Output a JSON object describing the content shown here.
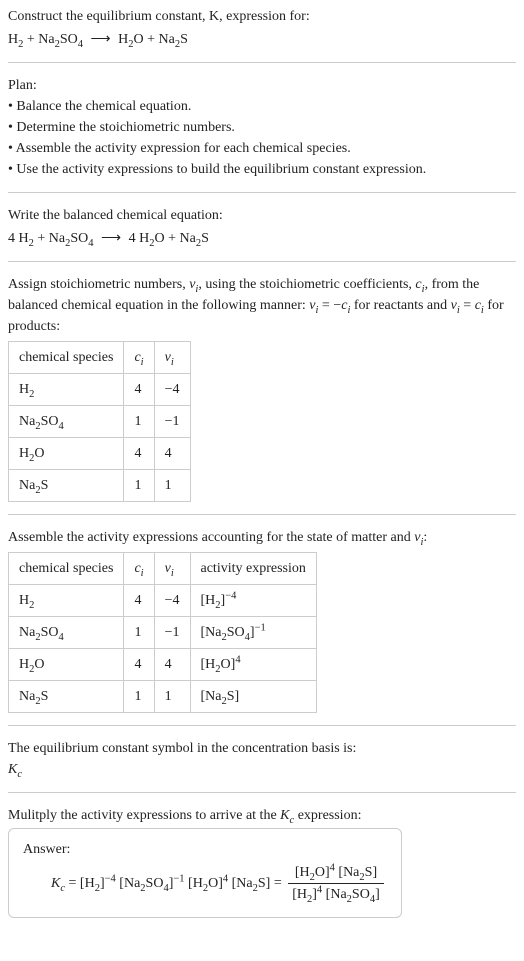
{
  "intro": {
    "l1": "Construct the equilibrium constant, K, expression for:",
    "eq_left_h2": "H",
    "eq_left_h2_sub": "2",
    "plus": " + ",
    "na2so4_a": "Na",
    "na2so4_b": "2",
    "na2so4_c": "SO",
    "na2so4_d": "4",
    "arrow": "⟶",
    "h2o_a": "H",
    "h2o_b": "2",
    "h2o_c": "O",
    "na2s_a": "Na",
    "na2s_b": "2",
    "na2s_c": "S"
  },
  "plan": {
    "header": "Plan:",
    "b1": "• Balance the chemical equation.",
    "b2": "• Determine the stoichiometric numbers.",
    "b3": "• Assemble the activity expression for each chemical species.",
    "b4": "• Use the activity expressions to build the equilibrium constant expression."
  },
  "balanced": {
    "header": "Write the balanced chemical equation:",
    "c1": "4 H",
    "c1s": "2",
    "plus": " + ",
    "c2a": "Na",
    "c2b": "2",
    "c2c": "SO",
    "c2d": "4",
    "arrow": "⟶",
    "c3": "4 H",
    "c3a": "2",
    "c3b": "O",
    "c4a": "Na",
    "c4b": "2",
    "c4c": "S"
  },
  "stoich": {
    "p1a": "Assign stoichiometric numbers, ",
    "nu": "ν",
    "nu_i": "i",
    "p1b": ", using the stoichiometric coefficients, ",
    "c": "c",
    "c_i": "i",
    "p1c": ", from the balanced chemical equation in the following manner: ",
    "eq1a": "ν",
    "eq1b": "i",
    "eq1c": " = −",
    "eq1d": "c",
    "eq1e": "i",
    "p1d": " for reactants and ",
    "eq2a": "ν",
    "eq2b": "i",
    "eq2c": " = ",
    "eq2d": "c",
    "eq2e": "i",
    "p1e": " for products:"
  },
  "table1": {
    "h1": "chemical species",
    "h2a": "c",
    "h2b": "i",
    "h3a": "ν",
    "h3b": "i",
    "rows": [
      {
        "s_a": "H",
        "s_b": "2",
        "s_c": "",
        "s_d": "",
        "c": "4",
        "v": "−4"
      },
      {
        "s_a": "Na",
        "s_b": "2",
        "s_c": "SO",
        "s_d": "4",
        "c": "1",
        "v": "−1"
      },
      {
        "s_a": "H",
        "s_b": "2",
        "s_c": "O",
        "s_d": "",
        "c": "4",
        "v": "4"
      },
      {
        "s_a": "Na",
        "s_b": "2",
        "s_c": "S",
        "s_d": "",
        "c": "1",
        "v": "1"
      }
    ]
  },
  "assemble": {
    "p1a": "Assemble the activity expressions accounting for the state of matter and ",
    "nu": "ν",
    "nu_i": "i",
    "colon": ":"
  },
  "table2": {
    "h1": "chemical species",
    "h2a": "c",
    "h2b": "i",
    "h3a": "ν",
    "h3b": "i",
    "h4": "activity expression",
    "r1": {
      "s_a": "H",
      "s_b": "2",
      "c": "4",
      "v": "−4",
      "ax_a": "[H",
      "ax_b": "2",
      "ax_c": "]",
      "exp": "−4"
    },
    "r2": {
      "s_a": "Na",
      "s_b": "2",
      "s_c": "SO",
      "s_d": "4",
      "c": "1",
      "v": "−1",
      "ax_a": "[Na",
      "ax_b": "2",
      "ax_c": "SO",
      "ax_d": "4",
      "ax_e": "]",
      "exp": "−1"
    },
    "r3": {
      "s_a": "H",
      "s_b": "2",
      "s_c": "O",
      "c": "4",
      "v": "4",
      "ax_a": "[H",
      "ax_b": "2",
      "ax_c": "O]",
      "exp": "4"
    },
    "r4": {
      "s_a": "Na",
      "s_b": "2",
      "s_c": "S",
      "c": "1",
      "v": "1",
      "ax_a": "[Na",
      "ax_b": "2",
      "ax_c": "S]"
    }
  },
  "symbol": {
    "p": "The equilibrium constant symbol in the concentration basis is:",
    "k": "K",
    "ks": "c"
  },
  "mult": {
    "p1a": "Mulitply the activity expressions to arrive at the ",
    "k": "K",
    "ks": "c",
    "p1b": " expression:"
  },
  "answer": {
    "label": "Answer:",
    "k": "K",
    "ks": "c",
    "eq": " = ",
    "t1a": "[H",
    "t1b": "2",
    "t1c": "]",
    "t1e": "−4",
    "sp": " ",
    "t2a": "[Na",
    "t2b": "2",
    "t2c": "SO",
    "t2d": "4",
    "t2e": "]",
    "t2x": "−1",
    "t3a": "[H",
    "t3b": "2",
    "t3c": "O]",
    "t3e": "4",
    "t4a": "[Na",
    "t4b": "2",
    "t4c": "S]",
    "eq2": " = ",
    "num1a": "[H",
    "num1b": "2",
    "num1c": "O]",
    "num1e": "4",
    "num2a": "[Na",
    "num2b": "2",
    "num2c": "S]",
    "den1a": "[H",
    "den1b": "2",
    "den1c": "]",
    "den1e": "4",
    "den2a": "[Na",
    "den2b": "2",
    "den2c": "SO",
    "den2d": "4",
    "den2e": "]"
  }
}
